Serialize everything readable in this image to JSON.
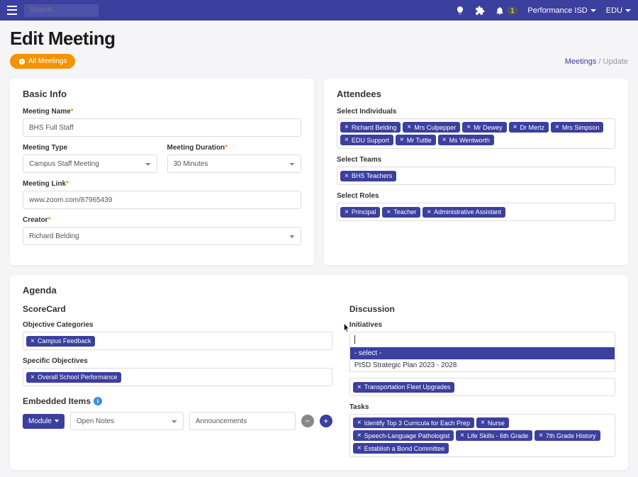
{
  "topbar": {
    "search_placeholder": "Search...",
    "notif_count": "1",
    "org": "Performance ISD",
    "user": "EDU"
  },
  "header": {
    "title": "Edit Meeting",
    "all_meetings": "All Meetings",
    "breadcrumb_link": "Meetings",
    "breadcrumb_sep": "/",
    "breadcrumb_current": "Update"
  },
  "basic": {
    "card_title": "Basic Info",
    "name_label": "Meeting Name",
    "name_value": "BHS Full Staff",
    "type_label": "Meeting Type",
    "type_value": "Campus Staff Meeting",
    "duration_label": "Meeting Duration",
    "duration_value": "30 Minutes",
    "link_label": "Meeting Link",
    "link_value": "www.zoom.com/87965439",
    "creator_label": "Creator",
    "creator_value": "Richard Belding"
  },
  "attendees": {
    "card_title": "Attendees",
    "individuals_label": "Select Individuals",
    "individuals": [
      "Richard Belding",
      "Mrs Culpepper",
      "Mr Dewey",
      "Dr Mertz",
      "Mrs Simpson",
      "EDU Support",
      "Mr Tuttle",
      "Ms Wentworth"
    ],
    "teams_label": "Select Teams",
    "teams": [
      "BHS Teachers"
    ],
    "roles_label": "Select Roles",
    "roles": [
      "Principal",
      "Teacher",
      "Administrative Assistant"
    ]
  },
  "agenda": {
    "card_title": "Agenda",
    "scorecard_title": "ScoreCard",
    "obj_cat_label": "Objective Categories",
    "obj_cats": [
      "Campus Feedback"
    ],
    "spec_obj_label": "Specific Objectives",
    "spec_objs": [
      "Overall School Performance"
    ],
    "embedded_title": "Embedded Items",
    "module_label": "Module",
    "open_notes": "Open Notes",
    "announcements": "Announcements"
  },
  "discussion": {
    "title": "Discussion",
    "initiatives_label": "Initiatives",
    "dd_placeholder": "- select -",
    "dd_option1": "PISD Strategic Plan 2023 - 2028",
    "init_chips": [
      "Transportation Fleet Upgrades"
    ],
    "tasks_label": "Tasks",
    "tasks": [
      "Identify Top 3 Curricula for Each Prep",
      "Nurse",
      "Speech-Language Pathologist",
      "Life Skills - 6th Grade",
      "7th Grade History",
      "Establish a Bond Committee"
    ]
  }
}
